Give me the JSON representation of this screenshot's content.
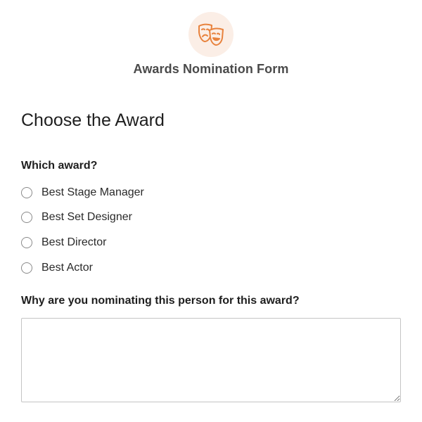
{
  "header": {
    "logo_icon": "theater-masks-icon",
    "title": "Awards Nomination Form",
    "accent_color": "#e8823d",
    "logo_bg_color": "#fbeee6"
  },
  "section": {
    "title": "Choose the Award"
  },
  "award_question": {
    "label": "Which award?",
    "options": [
      {
        "label": "Best Stage Manager",
        "selected": false
      },
      {
        "label": "Best Set Designer",
        "selected": false
      },
      {
        "label": "Best Director",
        "selected": false
      },
      {
        "label": "Best Actor",
        "selected": false
      }
    ]
  },
  "reason_question": {
    "label": "Why are you nominating this person for this award?",
    "value": ""
  }
}
